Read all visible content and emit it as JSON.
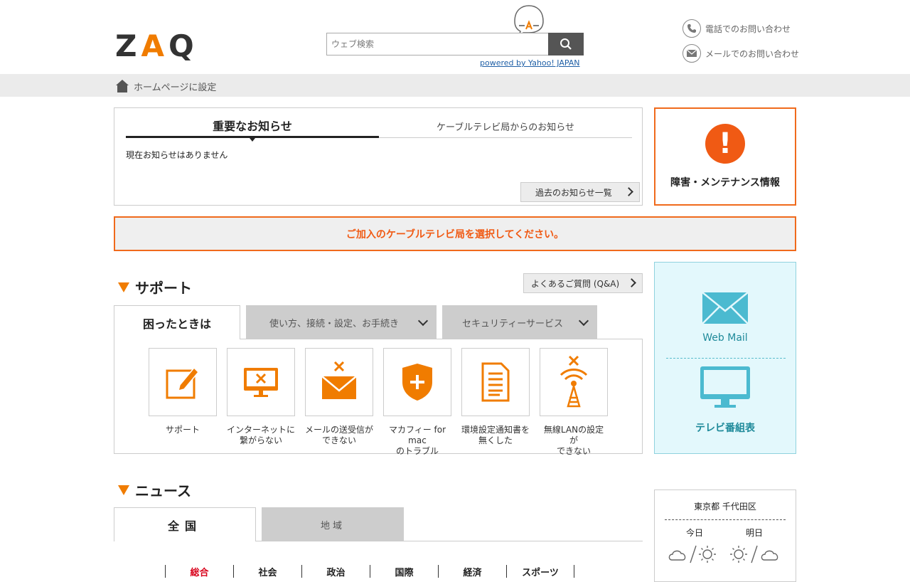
{
  "header": {
    "logo_text_1": "Z",
    "logo_text_2": "A",
    "logo_text_3": "Q",
    "search_placeholder": "ウェブ検索",
    "powered_by": "powered by Yahoo! JAPAN",
    "contact_phone": "電話でのお問い合わせ",
    "contact_mail": "メールでのお問い合わせ"
  },
  "subbar": {
    "home_link": "ホームページに設定"
  },
  "notice": {
    "tabs": [
      "重要なお知らせ",
      "ケーブルテレビ局からのお知らせ"
    ],
    "empty_text": "現在お知らせはありません",
    "past_button": "過去のお知らせ一覧"
  },
  "maintenance": {
    "icon_text": "!",
    "label": "障害・メンテナンス情報"
  },
  "select_station": "ご加入のケーブルテレビ局を選択してください。",
  "support": {
    "title": "サポート",
    "faq_button": "よくあるご質問 (Q&A)",
    "tabs": [
      "困ったときは",
      "使い方、接続・設定、お手続き",
      "セキュリティーサービス"
    ],
    "items": [
      {
        "label1": "サポート",
        "label2": ""
      },
      {
        "label1": "インターネットに",
        "label2": "繋がらない"
      },
      {
        "label1": "メールの送受信が",
        "label2": "できない"
      },
      {
        "label1": "マカフィー for mac",
        "label2": "のトラブル"
      },
      {
        "label1": "環境設定通知書を",
        "label2": "無くした"
      },
      {
        "label1": "無線LANの設定が",
        "label2": "できない"
      }
    ]
  },
  "side": {
    "webmail": "Web Mail",
    "tv": "テレビ番組表"
  },
  "news": {
    "title": "ニュース",
    "tabs": [
      "全国",
      "地域"
    ],
    "categories": [
      "総合",
      "社会",
      "政治",
      "国際",
      "経済",
      "スポーツ"
    ]
  },
  "weather": {
    "location": "東京都 千代田区",
    "today": "今日",
    "tomorrow": "明日"
  },
  "colors": {
    "accent": "#f06a1c",
    "cyan": "#e3f8fc",
    "link": "#1f5fa6"
  }
}
